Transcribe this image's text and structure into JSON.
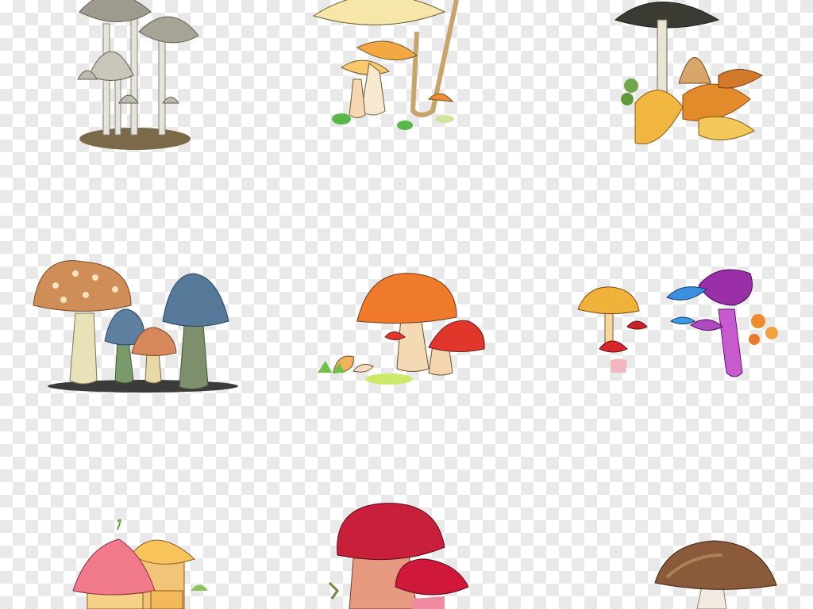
{
  "image": {
    "background": "transparency-checkerboard",
    "checker_colors": [
      "#ffffff",
      "#e9e9e9"
    ],
    "subjects": [
      "mushroom-cluster-gray-inkcaps",
      "mushroom-cluster-yellow-orange-sketch",
      "mushroom-with-autumn-leaves",
      "cartoon-mushrooms-spotted-and-blue",
      "watercolor-red-orange-mushrooms",
      "colorful-mushrooms-purple-blue-red",
      "mushroom-fairy-houses",
      "red-capped-mushrooms",
      "brown-capped-mushroom"
    ]
  }
}
